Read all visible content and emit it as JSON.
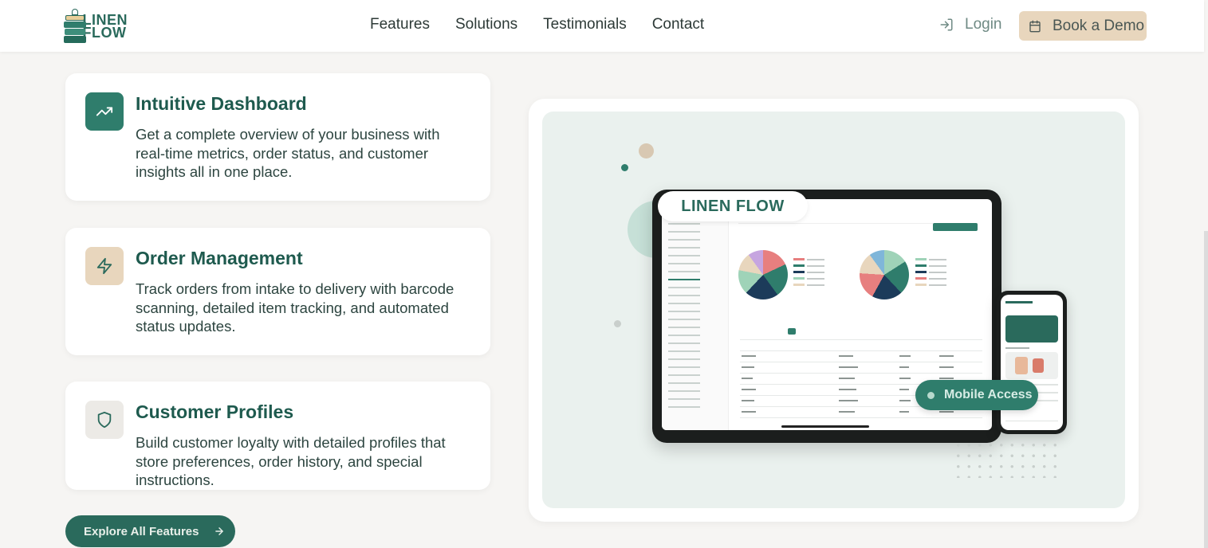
{
  "header": {
    "logo_text_line1": "LINEN",
    "logo_text_line2": "FLOW",
    "nav": [
      "Features",
      "Solutions",
      "Testimonials",
      "Contact"
    ],
    "login_label": "Login",
    "demo_label": "Book a Demo"
  },
  "features": [
    {
      "icon": "trending-up-icon",
      "title": "Intuitive Dashboard",
      "description": "Get a complete overview of your business with real-time metrics, order status, and customer insights all in one place."
    },
    {
      "icon": "lightning-icon",
      "title": "Order Management",
      "description": "Track orders from intake to delivery with barcode scanning, detailed item tracking, and automated status updates."
    },
    {
      "icon": "shield-icon",
      "title": "Customer Profiles",
      "description": "Build customer loyalty with detailed profiles that store preferences, order history, and special instructions."
    }
  ],
  "explore_label": "Explore All Features",
  "showcase": {
    "brand_label": "LINEN FLOW",
    "mobile_label": "Mobile Access"
  },
  "colors": {
    "brand_green": "#2a6a5c",
    "accent_tan": "#e8d6bd",
    "background": "#f6f5f3"
  }
}
